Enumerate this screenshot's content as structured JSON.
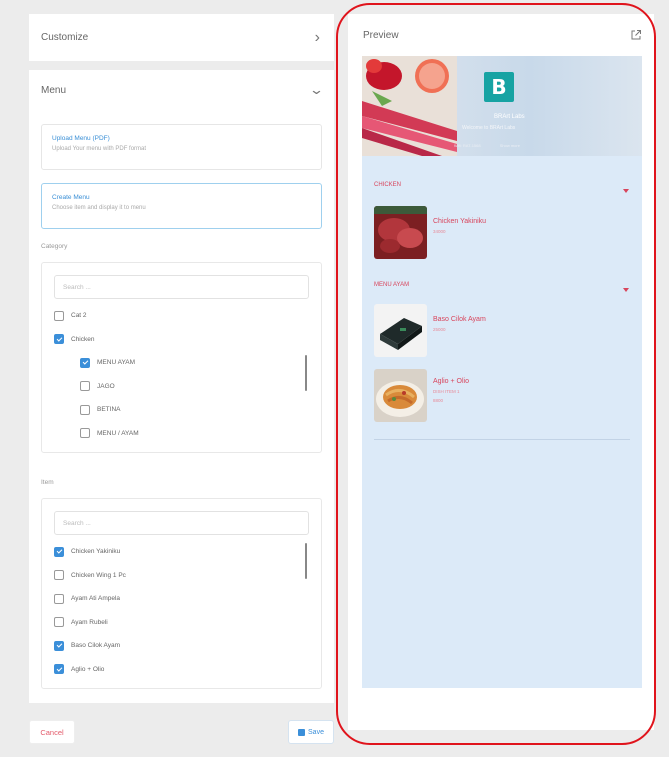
{
  "customize": {
    "title": "Customize",
    "chevron": "chevron-right-icon"
  },
  "menu": {
    "title": "Menu",
    "chevron": "chevron-down-icon",
    "upload_option": {
      "title": "Upload Menu (PDF)",
      "desc": "Upload Your menu with PDF format"
    },
    "create_option": {
      "title": "Create Menu",
      "desc": "Choose item and display it to menu"
    },
    "category_label": "Category",
    "category_search_placeholder": "Search ...",
    "categories": [
      {
        "label": "Cat 2",
        "checked": false,
        "level": 0
      },
      {
        "label": "Chicken",
        "checked": true,
        "level": 0
      },
      {
        "label": "MENU AYAM",
        "checked": true,
        "level": 1
      },
      {
        "label": "JAGO",
        "checked": false,
        "level": 1
      },
      {
        "label": "BETINA",
        "checked": false,
        "level": 1
      },
      {
        "label": "MENU / AYAM",
        "checked": false,
        "level": 1
      }
    ],
    "item_label": "Item",
    "item_search_placeholder": "Search ...",
    "items": [
      {
        "label": "Chicken Yakiniku",
        "checked": true
      },
      {
        "label": "Chicken Wing 1 Pc",
        "checked": false
      },
      {
        "label": "Ayam Ati Ampela",
        "checked": false
      },
      {
        "label": "Ayam Rubeli",
        "checked": false
      },
      {
        "label": "Baso Cilok Ayam",
        "checked": true
      },
      {
        "label": "Aglio + Olio",
        "checked": true
      }
    ]
  },
  "actions": {
    "cancel": "Cancel",
    "save": "Save"
  },
  "preview": {
    "title": "Preview",
    "open_icon": "external-link-icon",
    "brand_name": "BRArt Labs",
    "brand_tagline": "Welcome to BRArt Labs",
    "brand_link_1": "Wifi: RAT-1568",
    "brand_link_2": "Show more",
    "sections": [
      {
        "name": "CHICKEN",
        "items": [
          {
            "name": "Chicken Yakiniku",
            "price": "34000",
            "desc": ""
          }
        ]
      },
      {
        "name": "MENU AYAM",
        "items": [
          {
            "name": "Baso Cilok Ayam",
            "price": "25000",
            "desc": ""
          },
          {
            "name": "Aglio + Olio",
            "price": "8800",
            "desc": "DISH ITEM 1"
          }
        ]
      }
    ]
  },
  "colors": {
    "accent": "#3b8fd9",
    "danger": "#d8455c",
    "preview_bg": "#dceaf8",
    "highlight_outline": "#e0141c"
  }
}
